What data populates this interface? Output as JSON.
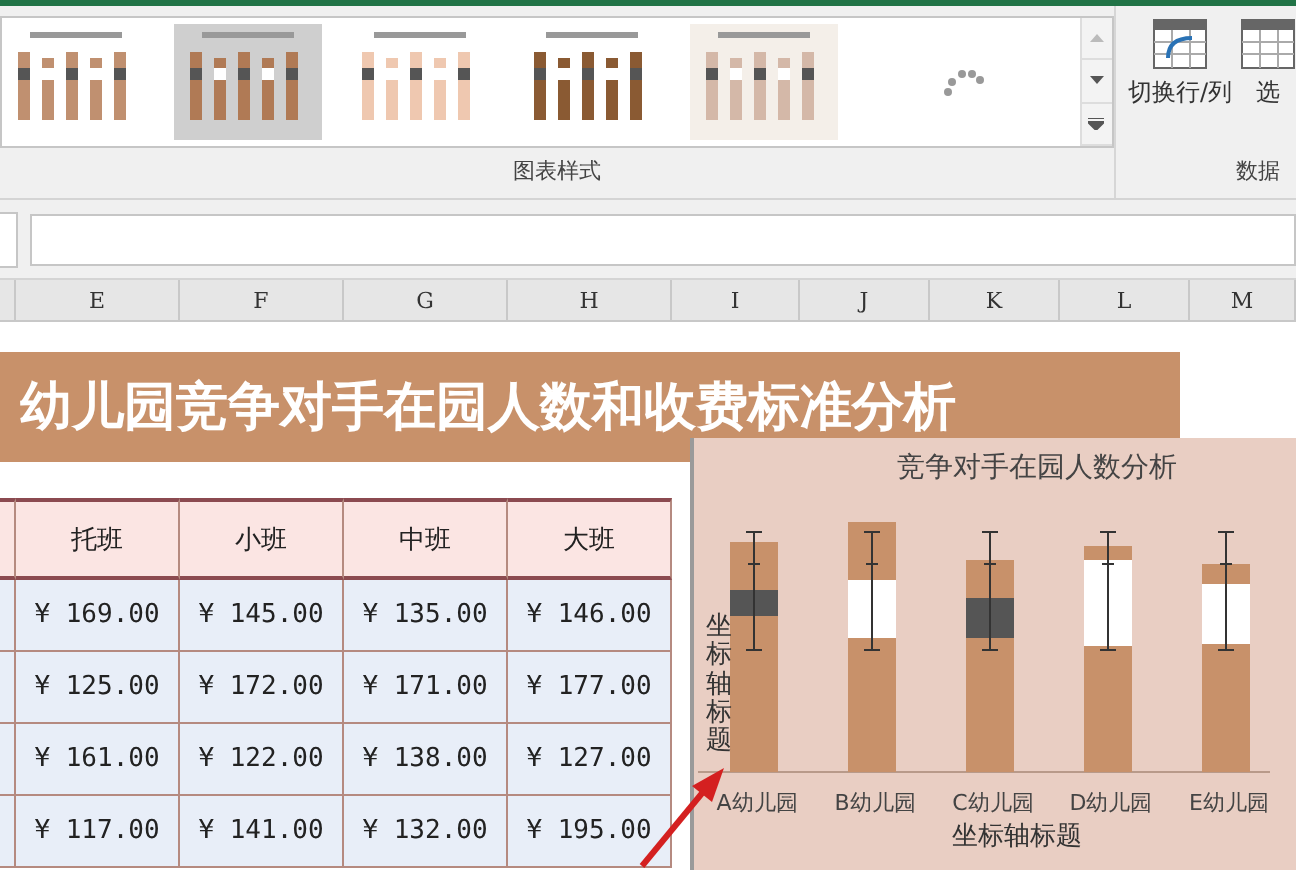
{
  "ribbon": {
    "gallery_label": "图表样式",
    "data_group": {
      "buttons": [
        "切换行/列",
        "选"
      ],
      "label": "数据"
    }
  },
  "columns": [
    "E",
    "F",
    "G",
    "H",
    "I",
    "J",
    "K",
    "L",
    "M"
  ],
  "banner": {
    "title": "幼儿园竞争对手在园人数和收费标准分析"
  },
  "table": {
    "header": [
      "托班",
      "小班",
      "中班",
      "大班"
    ],
    "rows": [
      [
        "¥ 169.00",
        "¥ 145.00",
        "¥ 135.00",
        "¥ 146.00"
      ],
      [
        "¥ 125.00",
        "¥ 172.00",
        "¥ 171.00",
        "¥ 177.00"
      ],
      [
        "¥ 161.00",
        "¥ 122.00",
        "¥ 138.00",
        "¥ 127.00"
      ],
      [
        "¥ 117.00",
        "¥ 141.00",
        "¥ 132.00",
        "¥ 195.00"
      ]
    ]
  },
  "chart": {
    "title": "竞争对手在园人数分析",
    "categories": [
      "A幼儿园",
      "B幼儿园",
      "C幼儿园",
      "D幼儿园",
      "E幼儿园"
    ],
    "vertical_axis_title": "坐标轴标题",
    "horizontal_axis_title": "坐标轴标题"
  }
}
